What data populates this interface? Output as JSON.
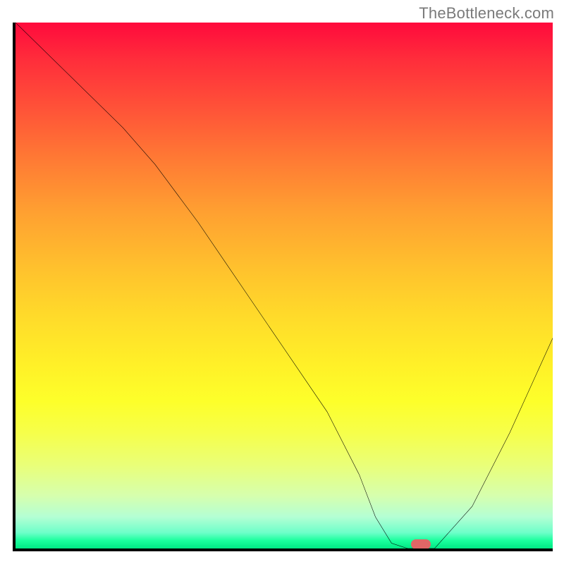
{
  "watermark": "TheBottleneck.com",
  "chart_data": {
    "type": "line",
    "title": "",
    "xlabel": "",
    "ylabel": "",
    "xlim": [
      0,
      100
    ],
    "ylim": [
      0,
      100
    ],
    "grid": false,
    "series": [
      {
        "name": "curve",
        "x": [
          0,
          10,
          20,
          26,
          34,
          42,
          50,
          58,
          64,
          67,
          70,
          73,
          78,
          85,
          92,
          100
        ],
        "y": [
          100,
          90,
          80,
          73,
          62,
          50,
          38,
          26,
          14,
          6,
          1,
          0,
          0,
          8,
          22,
          40
        ]
      }
    ],
    "marker": {
      "x": 75.5,
      "y": 0.8
    },
    "colors": {
      "axis": "#000000",
      "curve": "#000000",
      "marker": "#e06666",
      "gradient_top": "#ff0a3c",
      "gradient_bottom": "#00e884"
    }
  }
}
